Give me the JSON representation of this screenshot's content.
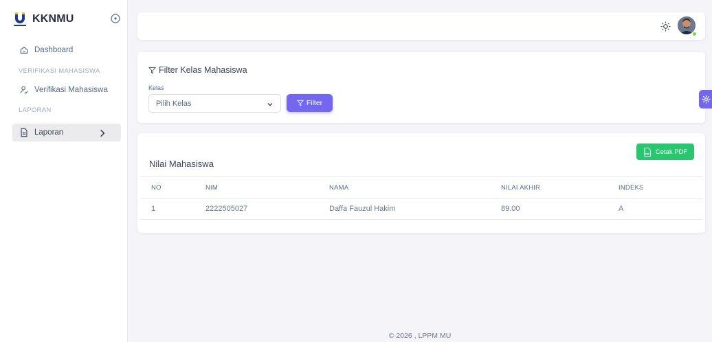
{
  "brand": {
    "name": "KKNMU"
  },
  "sidebar": {
    "items": [
      {
        "label": "Dashboard",
        "icon": "home-icon"
      },
      {
        "header": "VERIFIKASI MAHASISWA"
      },
      {
        "label": "Verifikasi Mahasiswa",
        "icon": "user-check-icon"
      },
      {
        "header": "LAPORAN"
      },
      {
        "label": "Laporan",
        "icon": "file-text-icon",
        "active": true
      }
    ]
  },
  "filter": {
    "title": "Filter Kelas Mahasiswa",
    "kelas_label": "Kelas",
    "select_value": "Pilih Kelas",
    "button_label": "Filter"
  },
  "table_card": {
    "title": "Nilai Mahasiswa",
    "pdf_button": "Cetak PDF",
    "columns": [
      "NO",
      "NIM",
      "NAMA",
      "NILAI AKHIR",
      "INDEKS"
    ],
    "rows": [
      [
        "1",
        "2222505027",
        "Daffa Fauzul Hakim",
        "89.00",
        "A"
      ]
    ]
  },
  "footer": {
    "text": "© 2026 , LPPM MU"
  },
  "colors": {
    "primary": "#7367f0",
    "success": "#28c76f",
    "online": "#71dd37"
  }
}
